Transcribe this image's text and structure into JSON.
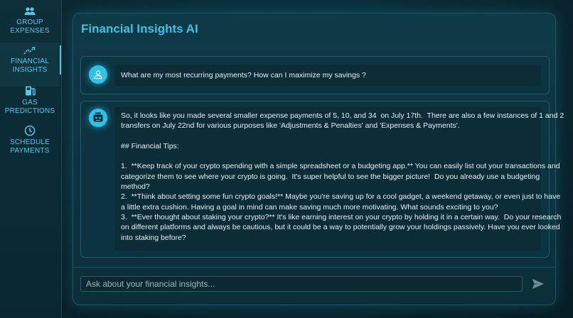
{
  "sidebar": {
    "items": [
      {
        "label": "GROUP EXPENSES",
        "icon": "group-icon",
        "active": false
      },
      {
        "label": "FINANCIAL INSIGHTS",
        "icon": "trending-up-icon",
        "active": true
      },
      {
        "label": "GAS PREDICTIONS",
        "icon": "gas-pump-icon",
        "active": false
      },
      {
        "label": "SCHEDULE PAYMENTS",
        "icon": "clock-icon",
        "active": false
      }
    ]
  },
  "header": {
    "title": "Financial Insights AI"
  },
  "chat": {
    "user_message": "What are my most recurring payments? How can I maximize my savings ?",
    "bot_lines": [
      "So, it looks like you made several smaller expense payments of 5, 10, and 34  on July 17th.  There are also a few instances of 1 and 2",
      "transfers on July 22nd for various purposes like 'Adjustments & Penalties' and 'Expenses & Payments'.",
      "",
      "## Financial Tips:",
      "",
      "1.  **Keep track of your crypto spending with a simple spreadsheet or a budgeting app.** You can easily list out your transactions and",
      "categorize them to see where your crypto is going.  It's super helpful to see the bigger picture!  Do you already use a budgeting",
      "method?",
      "2.  **Think about setting some fun crypto goals!** Maybe you're saving up for a cool gadget, a weekend getaway, or even just to have",
      "a little extra cushion. Having a goal in mind can make saving much more motivating. What sounds exciting to you?",
      "3.  **Ever thought about staking your crypto?** It's like earning interest on your crypto by holding it in a certain way.  Do your research",
      "on different platforms and always be cautious, but it could be a way to potentially grow your holdings passively. Have you ever looked",
      "into staking before?"
    ]
  },
  "input": {
    "placeholder": "Ask about your financial insights...",
    "value": ""
  },
  "colors": {
    "accent": "#3fc1e4",
    "background": "#0a2933",
    "avatar": "#2bc3ea"
  }
}
